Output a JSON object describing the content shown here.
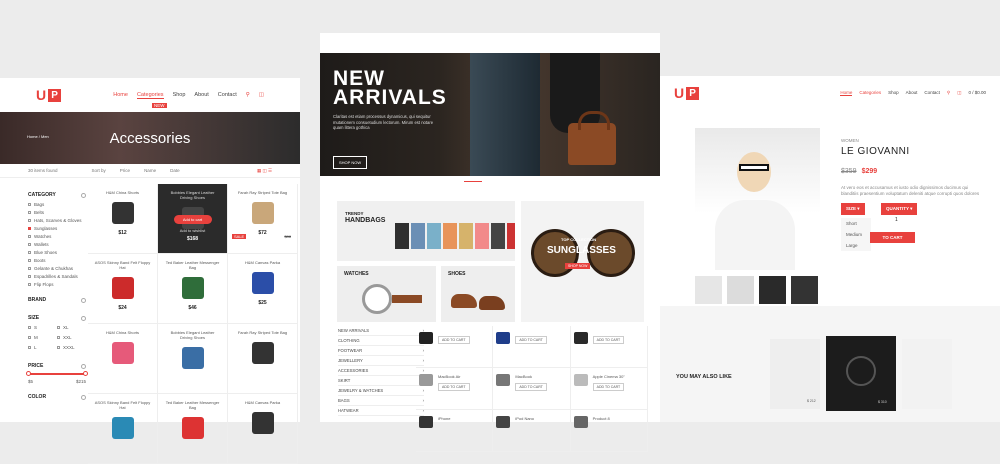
{
  "left": {
    "logo_letters": "U",
    "logo_box": "P",
    "nav": [
      "Home",
      "Categories",
      "Shop",
      "About",
      "Contact"
    ],
    "nav_badge": "NEW",
    "breadcrumb": "Home / Men",
    "hero_title": "Accessories",
    "toolbar": {
      "view": "30 items found",
      "sort_label": "Sort by",
      "sort_price": "Price",
      "sort_name": "Name",
      "sort_date": "Date"
    },
    "filters": {
      "category_title": "CATEGORY",
      "category_items": [
        "Bags",
        "Belts",
        "Hats, Scarves & Gloves",
        "Sunglasses",
        "Watches",
        "Wallets",
        "Blue Shoes",
        "Boots",
        "Gelante & Chukhas",
        "Espadrilles & Sandals",
        "Flip Flops"
      ],
      "brand_title": "BRAND",
      "size_title": "SIZE",
      "sizes": [
        "S",
        "XL",
        "M",
        "XXL",
        "L",
        "XXXL"
      ],
      "price_title": "PRICE",
      "price_min": "$5",
      "price_max": "$215",
      "color_title": "COLOR"
    },
    "products": [
      {
        "name": "H&M China Shorts",
        "price": "$12",
        "color": "#333"
      },
      {
        "name": "Bobbies Elegant Leather Driving Shoes",
        "price": "$168",
        "color": "#444",
        "dark": true,
        "action": "Add to cart",
        "wish": "Add to wishlist"
      },
      {
        "name": "Farah Ray Striped Tote Bag",
        "price": "$72",
        "old": "$88",
        "color": "#c9a77a",
        "sale": "SALE"
      },
      {
        "name": "ASOS Skinny Band Felt Floppy Hat",
        "price": "$24",
        "color": "#cc2b2b"
      },
      {
        "name": "Ted Baker Leather Messenger Bag",
        "price": "$46",
        "color": "#2f6d3a"
      },
      {
        "name": "H&M Canvas Parka",
        "price": "$25",
        "color": "#2b4ea8"
      },
      {
        "name": "H&M China Shorts",
        "price": "",
        "color": "#e65a7a"
      },
      {
        "name": "Bobbies Elegant Leather Driving Shoes",
        "price": "",
        "color": "#3a6ea5"
      },
      {
        "name": "Farah Ray Striped Tote Bag",
        "price": "",
        "color": "#333"
      },
      {
        "name": "ASOS Skinny Band Felt Floppy Hat",
        "price": "",
        "color": "#2a8ab5"
      },
      {
        "name": "Ted Baker Leather Messenger Bag",
        "price": "",
        "color": "#d33"
      },
      {
        "name": "H&M Canvas Parka",
        "price": "",
        "color": "#333"
      }
    ]
  },
  "center": {
    "banner_title_1": "NEW",
    "banner_title_2": "ARRIVALS",
    "banner_text": "Claritas est etiam processus dynamicus, qui sequitur mutationem consuetudium lectorum. Mirum est notare quam littera gothica",
    "banner_button": "SHOP NOW",
    "cat_trendy": "TRENDY",
    "cat_handbags": "HANDBAGS",
    "cat_top": "TOP COLLECTION",
    "cat_sunglasses": "SUNGLASSES",
    "cat_watches": "WATCHES",
    "cat_shoes": "SHOES",
    "menu": [
      "NEW ARRIVALS",
      "CLOTHING",
      "FOOTWEAR",
      "JEWELLERY",
      "ACCESSORIES",
      "SKIRT",
      "JEWELRY & WATCHES",
      "BAGS",
      "HATWEAR"
    ],
    "products": [
      {
        "name": "",
        "action": "ADD TO CART"
      },
      {
        "name": "",
        "action": "ADD TO CART"
      },
      {
        "name": "",
        "action": "ADD TO CART"
      },
      {
        "name": "MacBook Air",
        "action": "ADD TO CART"
      },
      {
        "name": "MacBook",
        "action": "ADD TO CART"
      },
      {
        "name": "Apple Cinema 30\"",
        "action": "ADD TO CART"
      },
      {
        "name": "iPhone",
        "action": ""
      },
      {
        "name": "iPod Nano",
        "action": ""
      },
      {
        "name": "Product 8",
        "action": ""
      }
    ]
  },
  "right": {
    "nav": [
      "Home",
      "Categories",
      "Shop",
      "About",
      "Contact"
    ],
    "cart_text": "0 / $0.00",
    "brand": "WOMEN",
    "title": "LE GIOVANNI",
    "old_price": "$359",
    "price": "$299",
    "description": "At vero eos et accusamus et iusto odio dignissimos ducimus qui blanditiis praesentium voluptatum deleniti atque corrupti quos dolores",
    "size_label": "SIZE",
    "quantity_label": "QUANTITY",
    "quantity_value": "1",
    "sizes": [
      "Short",
      "Medium",
      "Large"
    ],
    "add_to_cart": "TO CART",
    "also_like": "YOU MAY ALSO LIKE",
    "also_prices": [
      "$ 212",
      "$ 310"
    ]
  }
}
